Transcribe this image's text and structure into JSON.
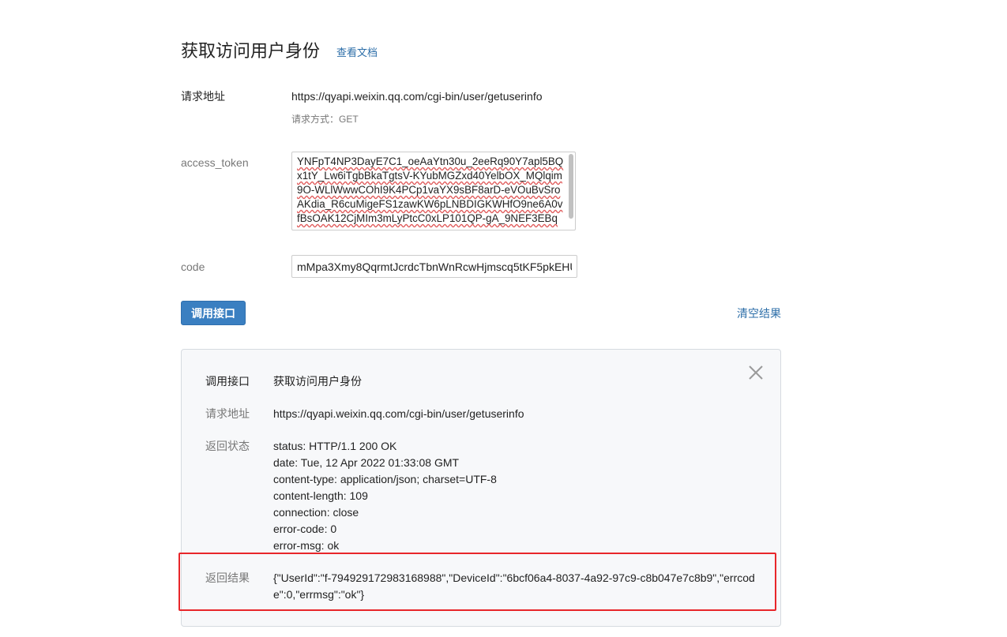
{
  "header": {
    "title": "获取访问用户身份",
    "doc_link": "查看文档"
  },
  "request": {
    "url_label": "请求地址",
    "url": "https://qyapi.weixin.qq.com/cgi-bin/user/getuserinfo",
    "method": "请求方式：GET"
  },
  "params": {
    "access_token_label": "access_token",
    "access_token_value": "YNFpT4NP3DayE7C1_oeAaYtn30u_2eeRq90Y7apl5BQx1tY_Lw6iTgbBkaTgtsV-KYubMGZxd40YelbOX_MQlqim9O-WLlWwwCOhI9K4PCp1vaYX9sBF8arD-eVOuBvSroAKdia_R6cuMigeFS1zawKW6pLNBDIGKWHfO9ne6A0vfBsOAK12CjMIm3mLyPtcC0xLP101QP-gA_9NEF3EBq",
    "code_label": "code",
    "code_value": "mMpa3Xmy8QqrmtJcrdcTbnWnRcwHjmscq5tKF5pkEHU"
  },
  "actions": {
    "call_button": "调用接口",
    "clear_results": "清空结果"
  },
  "result": {
    "call_label": "调用接口",
    "call_value": "获取访问用户身份",
    "url_label": "请求地址",
    "url_value": "https://qyapi.weixin.qq.com/cgi-bin/user/getuserinfo",
    "status_label": "返回状态",
    "status_lines": [
      "status: HTTP/1.1 200 OK",
      "date: Tue, 12 Apr 2022 01:33:08 GMT",
      "content-type: application/json; charset=UTF-8",
      "content-length: 109",
      "connection: close",
      "error-code: 0",
      "error-msg: ok"
    ],
    "result_label": "返回结果",
    "result_json": "{\"UserId\":\"f-794929172983168988\",\"DeviceId\":\"6bcf06a4-8037-4a92-97c9-c8b047e7c8b9\",\"errcode\":0,\"errmsg\":\"ok\"}"
  },
  "colors": {
    "primary_button": "#3a7fc1",
    "link": "#2c6ea8",
    "highlight": "#e8262a"
  }
}
